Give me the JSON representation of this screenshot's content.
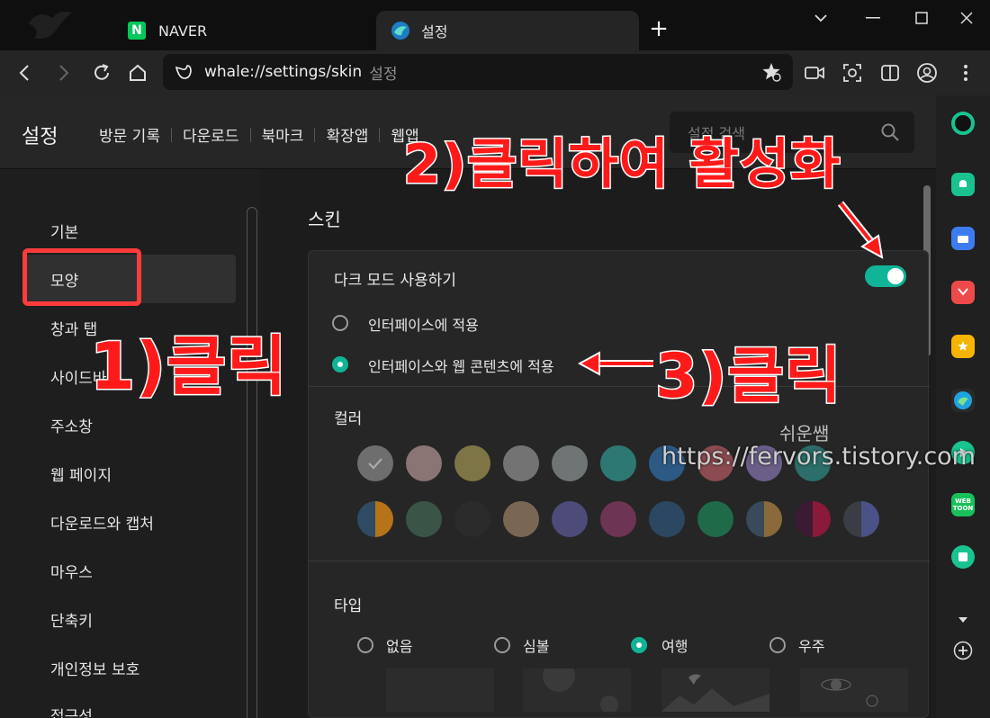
{
  "tabs": [
    {
      "label": "NAVER",
      "logo_letter": "N"
    },
    {
      "label": "설정"
    }
  ],
  "toolbar": {
    "url": "whale://settings/skin",
    "url_suffix": "설정"
  },
  "settings": {
    "title": "설정",
    "nav": [
      "방문 기록",
      "다운로드",
      "북마크",
      "확장앱",
      "웹앱"
    ],
    "search_placeholder": "설정 검색"
  },
  "leftnav": {
    "items": [
      "기본",
      "모양",
      "창과 탭",
      "사이드바",
      "주소창",
      "웹 페이지",
      "다운로드와 캡처",
      "마우스",
      "단축키",
      "개인정보 보호",
      "접근성"
    ],
    "active_index": 1
  },
  "skin": {
    "section_title": "스킨",
    "dark_mode_label": "다크 모드 사용하기",
    "dark_mode_on": true,
    "dark_options": [
      {
        "label": "인터페이스에 적용",
        "selected": false
      },
      {
        "label": "인터페이스와 웹 콘텐츠에 적용",
        "selected": true
      }
    ],
    "color_label": "컬러",
    "type_label": "타입",
    "types": [
      {
        "label": "없음",
        "selected": false
      },
      {
        "label": "심볼",
        "selected": false
      },
      {
        "label": "여행",
        "selected": true
      },
      {
        "label": "우주",
        "selected": false
      }
    ]
  },
  "swatches_row1": [
    "#6e6e6e",
    "#8a7474",
    "#7d7545",
    "#737373",
    "#6f7574",
    "#2e7873",
    "#2d5a84",
    "#8b4b50",
    "#6b5f8a",
    "#2b6e6a"
  ],
  "swatches_row2": [
    [
      "#2f4b63",
      "#b57417"
    ],
    [
      "#3a5448",
      "#3a5448"
    ],
    [
      "#2b2b2b",
      "#2b2b2b"
    ],
    [
      "#7a6753",
      "#7a6753"
    ],
    [
      "#4d4b78",
      "#4d4b78"
    ],
    [
      "#6e3453",
      "#6e3453"
    ],
    [
      "#2b4860",
      "#2b4860"
    ],
    [
      "#1f6a49",
      "#1f6a49"
    ],
    [
      "#3a4a5a",
      "#8a6a3a"
    ],
    [
      "#3c1a34",
      "#8a1a3a"
    ],
    [
      "#3a3d44",
      "#4a5288"
    ]
  ],
  "annotations": {
    "a1": "1)클릭",
    "a2": "2)클릭하여 활성화",
    "a3": "3)클릭"
  },
  "watermark": {
    "name": "쉬운쌤",
    "url": "https://fervors.tistory.com"
  },
  "colors": {
    "accent": "#10b496",
    "annotation": "#ff1a1a"
  }
}
